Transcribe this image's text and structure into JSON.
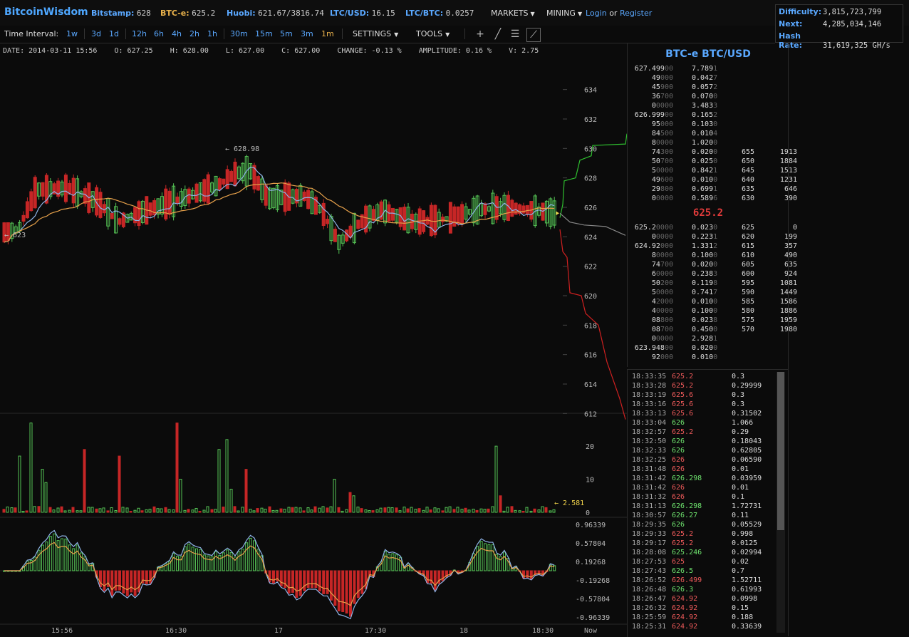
{
  "brand": "BitcoinWisdom",
  "tickers": [
    {
      "label": "Bitstamp:",
      "value": "628",
      "style": "lbl"
    },
    {
      "label": "BTC-e:",
      "value": "625.2",
      "style": "btc"
    },
    {
      "label": "Huobi:",
      "value": "621.67/3816.74",
      "style": "lbl"
    },
    {
      "label": "LTC/USD:",
      "value": "16.15",
      "style": "lbl"
    },
    {
      "label": "LTC/BTC:",
      "value": "0.0257",
      "style": "lbl"
    }
  ],
  "menus": {
    "markets": "MARKETS",
    "mining": "MINING",
    "login": "Login",
    "or": "or",
    "register": "Register"
  },
  "network": {
    "difficulty_label": "Difficulty:",
    "difficulty": "3,815,723,799",
    "next_label": "Next:",
    "next": "4,285,034,146",
    "hashrate_label": "Hash Rate:",
    "hashrate": "31,619,325 GH/s"
  },
  "toolbar": {
    "interval_label": "Time Interval:",
    "intervals": [
      "1w",
      "3d",
      "1d",
      "12h",
      "6h",
      "4h",
      "2h",
      "1h",
      "30m",
      "15m",
      "5m",
      "3m",
      "1m"
    ],
    "active_interval": "1m",
    "settings": "SETTINGS",
    "tools": "TOOLS"
  },
  "ohlc": {
    "date": "DATE: 2014-03-11 15:56",
    "open": "O: 627.25",
    "high": "H: 628.00",
    "low": "L: 627.00",
    "close": "C: 627.00",
    "change": "CHANGE: -0.13 %",
    "amplitude": "AMPLITUDE: 0.16 %",
    "volume": "V: 2.75"
  },
  "chart_data": {
    "type": "candlestick",
    "price_axis": [
      "634",
      "632",
      "630",
      "628",
      "626",
      "624",
      "622",
      "620",
      "618",
      "616",
      "614",
      "612"
    ],
    "price_range": [
      611,
      635
    ],
    "volume_axis": [
      "20",
      "10",
      "0"
    ],
    "volume_range": [
      0,
      28
    ],
    "macd_axis": [
      "0.96339",
      "0.57804",
      "0.19268",
      "-0.19268",
      "-0.57804",
      "-0.96339"
    ],
    "macd_range": [
      -1.1,
      1.1
    ],
    "time_labels": [
      "15:56",
      "16:30",
      "17",
      "17:30",
      "18",
      "18:30",
      "Now"
    ],
    "high_marker": "← 628.98",
    "low_marker": "← 623",
    "last_volume_marker": "← 2.581",
    "depth_color_bid": "#2fbf2f",
    "depth_color_ask": "#d02020"
  },
  "orderbook": {
    "title": "BTC-e BTC/USD",
    "asks": [
      {
        "p": "627.499",
        "pd": "00",
        "a": "7.789",
        "ad": "1",
        "dp": "",
        "dc": ""
      },
      {
        "p": "49",
        "pd": "000",
        "a": "0.042",
        "ad": "7",
        "dp": "",
        "dc": ""
      },
      {
        "p": "45",
        "pd": "900",
        "a": "0.057",
        "ad": "2",
        "dp": "",
        "dc": ""
      },
      {
        "p": "36",
        "pd": "700",
        "a": "0.070",
        "ad": "0",
        "dp": "",
        "dc": ""
      },
      {
        "p": "0",
        "pd": "0000",
        "a": "3.483",
        "ad": "3",
        "dp": "",
        "dc": ""
      },
      {
        "p": "626.999",
        "pd": "00",
        "a": "0.165",
        "ad": "2",
        "dp": "",
        "dc": ""
      },
      {
        "p": "95",
        "pd": "000",
        "a": "0.103",
        "ad": "0",
        "dp": "",
        "dc": ""
      },
      {
        "p": "84",
        "pd": "500",
        "a": "0.010",
        "ad": "4",
        "dp": "",
        "dc": ""
      },
      {
        "p": "8",
        "pd": "0000",
        "a": "1.020",
        "ad": "0",
        "dp": "",
        "dc": ""
      },
      {
        "p": "74",
        "pd": "300",
        "a": "0.020",
        "ad": "0",
        "dp": "655",
        "dc": "1913"
      },
      {
        "p": "50",
        "pd": "700",
        "a": "0.025",
        "ad": "0",
        "dp": "650",
        "dc": "1884"
      },
      {
        "p": "5",
        "pd": "0000",
        "a": "0.842",
        "ad": "1",
        "dp": "645",
        "dc": "1513"
      },
      {
        "p": "49",
        "pd": "600",
        "a": "0.010",
        "ad": "0",
        "dp": "640",
        "dc": "1231"
      },
      {
        "p": "29",
        "pd": "800",
        "a": "0.699",
        "ad": "1",
        "dp": "635",
        "dc": "646"
      },
      {
        "p": "0",
        "pd": "0000",
        "a": "0.589",
        "ad": "6",
        "dp": "630",
        "dc": "390"
      }
    ],
    "mid": "625.2",
    "bids": [
      {
        "p": "625.2",
        "pd": "0000",
        "a": "0.023",
        "ad": "0",
        "dp": "625",
        "dc": "0"
      },
      {
        "p": "0",
        "pd": "0000",
        "a": "0.223",
        "ad": "1",
        "dp": "620",
        "dc": "199"
      },
      {
        "p": "624.92",
        "pd": "000",
        "a": "1.331",
        "ad": "2",
        "dp": "615",
        "dc": "357"
      },
      {
        "p": "8",
        "pd": "0000",
        "a": "0.100",
        "ad": "0",
        "dp": "610",
        "dc": "490"
      },
      {
        "p": "74",
        "pd": "700",
        "a": "0.020",
        "ad": "0",
        "dp": "605",
        "dc": "635"
      },
      {
        "p": "6",
        "pd": "0000",
        "a": "0.238",
        "ad": "3",
        "dp": "600",
        "dc": "924"
      },
      {
        "p": "50",
        "pd": "200",
        "a": "0.119",
        "ad": "8",
        "dp": "595",
        "dc": "1081"
      },
      {
        "p": "5",
        "pd": "0000",
        "a": "0.741",
        "ad": "7",
        "dp": "590",
        "dc": "1449"
      },
      {
        "p": "4",
        "pd": "2000",
        "a": "0.010",
        "ad": "0",
        "dp": "585",
        "dc": "1586"
      },
      {
        "p": "4",
        "pd": "0000",
        "a": "0.100",
        "ad": "0",
        "dp": "580",
        "dc": "1886"
      },
      {
        "p": "08",
        "pd": "800",
        "a": "0.023",
        "ad": "8",
        "dp": "575",
        "dc": "1959"
      },
      {
        "p": "08",
        "pd": "700",
        "a": "0.450",
        "ad": "0",
        "dp": "570",
        "dc": "1980"
      },
      {
        "p": "0",
        "pd": "0000",
        "a": "2.928",
        "ad": "1",
        "dp": "",
        "dc": ""
      },
      {
        "p": "623.948",
        "pd": "00",
        "a": "0.020",
        "ad": "0",
        "dp": "",
        "dc": ""
      },
      {
        "p": "92",
        "pd": "000",
        "a": "0.010",
        "ad": "0",
        "dp": "",
        "dc": ""
      }
    ]
  },
  "trades": [
    {
      "t": "18:33:35",
      "p": "625.2",
      "d": "dn",
      "a": "0.3"
    },
    {
      "t": "18:33:28",
      "p": "625.2",
      "d": "dn",
      "a": "0.29999"
    },
    {
      "t": "18:33:19",
      "p": "625.6",
      "d": "dn",
      "a": "0.3"
    },
    {
      "t": "18:33:16",
      "p": "625.6",
      "d": "dn",
      "a": "0.3"
    },
    {
      "t": "18:33:13",
      "p": "625.6",
      "d": "dn",
      "a": "0.31502"
    },
    {
      "t": "18:33:04",
      "p": "626",
      "d": "up",
      "a": "1.066"
    },
    {
      "t": "18:32:57",
      "p": "625.2",
      "d": "dn",
      "a": "0.29"
    },
    {
      "t": "18:32:50",
      "p": "626",
      "d": "up",
      "a": "0.18043"
    },
    {
      "t": "18:32:33",
      "p": "626",
      "d": "up",
      "a": "0.62805"
    },
    {
      "t": "18:32:25",
      "p": "626",
      "d": "dn",
      "a": "0.06590"
    },
    {
      "t": "18:31:48",
      "p": "626",
      "d": "dn",
      "a": "0.01"
    },
    {
      "t": "18:31:42",
      "p": "626.298",
      "d": "up",
      "a": "0.03959"
    },
    {
      "t": "18:31:42",
      "p": "626",
      "d": "dn",
      "a": "0.01"
    },
    {
      "t": "18:31:32",
      "p": "626",
      "d": "dn",
      "a": "0.1"
    },
    {
      "t": "18:31:13",
      "p": "626.298",
      "d": "up",
      "a": "1.72731"
    },
    {
      "t": "18:30:57",
      "p": "626.27",
      "d": "up",
      "a": "0.11"
    },
    {
      "t": "18:29:35",
      "p": "626",
      "d": "up",
      "a": "0.05529"
    },
    {
      "t": "18:29:33",
      "p": "625.2",
      "d": "dn",
      "a": "0.998"
    },
    {
      "t": "18:29:17",
      "p": "625.2",
      "d": "dn",
      "a": "0.0125"
    },
    {
      "t": "18:28:08",
      "p": "625.246",
      "d": "up",
      "a": "0.02994"
    },
    {
      "t": "18:27:53",
      "p": "625",
      "d": "dn",
      "a": "0.02"
    },
    {
      "t": "18:27:43",
      "p": "626.5",
      "d": "up",
      "a": "0.7"
    },
    {
      "t": "18:26:52",
      "p": "626.499",
      "d": "dn",
      "a": "1.52711"
    },
    {
      "t": "18:26:48",
      "p": "626.3",
      "d": "up",
      "a": "0.61993"
    },
    {
      "t": "18:26:47",
      "p": "624.92",
      "d": "dn",
      "a": "0.0998"
    },
    {
      "t": "18:26:32",
      "p": "624.92",
      "d": "dn",
      "a": "0.15"
    },
    {
      "t": "18:25:59",
      "p": "624.92",
      "d": "dn",
      "a": "0.188"
    },
    {
      "t": "18:25:31",
      "p": "624.92",
      "d": "dn",
      "a": "0.33639"
    }
  ]
}
